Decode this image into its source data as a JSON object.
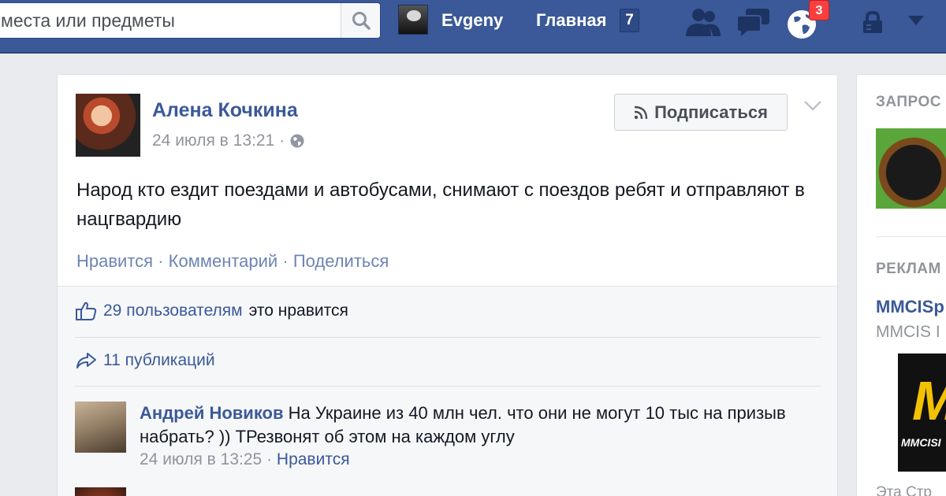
{
  "header": {
    "search_value": "места или предметы",
    "user_name": "Evgeny",
    "home_label": "Главная",
    "home_count": "7",
    "notifications_badge": "3",
    "colors": {
      "bar": "#3b5998",
      "badge": "#fa3e3e"
    }
  },
  "post": {
    "author": "Алена Кочкина",
    "timestamp": "24 июля в 13:21",
    "separator": "·",
    "follow_label": "Подписаться",
    "text": "Народ кто ездит поездами и автобусами, снимают с поездов ребят и отправляют в нацгвардию",
    "actions": {
      "like": "Нравится",
      "comment": "Комментарий",
      "share": "Поделиться",
      "dot": "·"
    },
    "likes": {
      "count_link": "29 пользователям",
      "suffix": "это нравится"
    },
    "shares": "11 публикаций",
    "comments": [
      {
        "author": "Андрей Новиков",
        "text": "На Украине из 40 млн чел. что они не могут 10 тыс на призыв набрать? )) ТРезвонят об этом на каждом углу",
        "timestamp": "24 июля в 13:25",
        "like": "Нравится"
      }
    ]
  },
  "sidebar": {
    "requests_heading": "ЗАПРОС",
    "ads_heading": "РЕКЛАМ",
    "ad_title": "MMCISp",
    "ad_subtitle": "MMCIS I",
    "ad_logo_letter": "M",
    "ad_logo_text": "MMCISI",
    "footer_text": "Эта Стр"
  }
}
